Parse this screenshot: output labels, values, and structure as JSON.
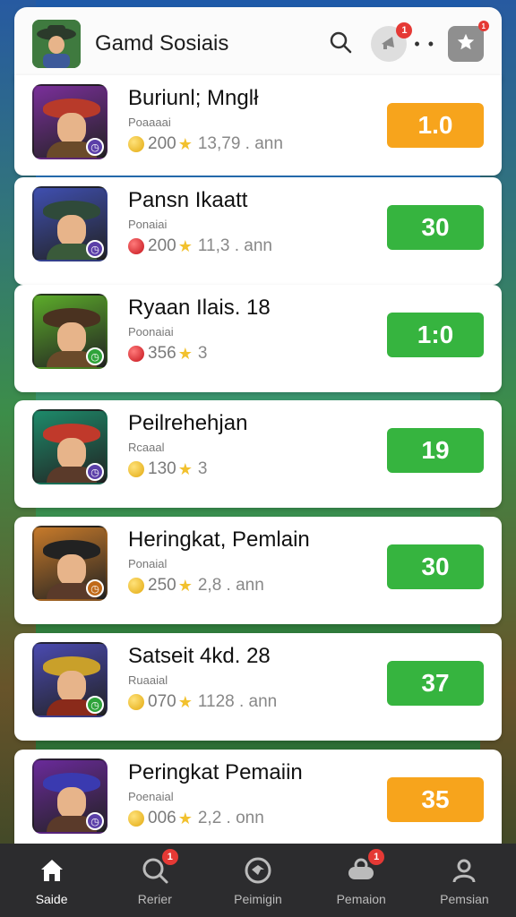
{
  "header": {
    "title": "Gamd Sosiais",
    "notif_count_1": "1",
    "notif_count_2": "1"
  },
  "rows": [
    {
      "name": "Buriunl; Mnglł",
      "sub": "Poaaaai",
      "gem": "gold",
      "coins": "200",
      "extra": "13,79 . ann",
      "score": "1.0",
      "score_color": "orange",
      "theme": {
        "bg": "#7a2f9a",
        "hat": "#b83a2a",
        "body": "#6a4a2a",
        "lvl": "#5b3fa8"
      }
    },
    {
      "name": "Pansn Ikaatt",
      "sub": "Ponaiai",
      "gem": "red",
      "coins": "200",
      "extra": "11,3 . ann",
      "score": "30",
      "score_color": "green",
      "theme": {
        "bg": "#3f4fb0",
        "hat": "#2f4a3a",
        "body": "#3a5a3a",
        "lvl": "#5b3fa8"
      }
    },
    {
      "name": "Ryaan Ilais. 18",
      "sub": "Poonaiai",
      "gem": "red",
      "coins": "356",
      "extra": "3",
      "score": "1:0",
      "score_color": "green",
      "theme": {
        "bg": "#5cab2a",
        "hat": "#4a3220",
        "body": "#6a4a2a",
        "lvl": "#2fa33a"
      }
    },
    {
      "name": "Peilrehehjan",
      "sub": "Rcaaal",
      "gem": "gold",
      "coins": "130",
      "extra": "3",
      "score": "19",
      "score_color": "green",
      "theme": {
        "bg": "#1d8a6a",
        "hat": "#c0392b",
        "body": "#5a3a2a",
        "lvl": "#5b3fa8"
      }
    },
    {
      "name": "Heringkat, Pemlain",
      "sub": "Ponaial",
      "gem": "gold",
      "coins": "250",
      "extra": "2,8 . ann",
      "score": "30",
      "score_color": "green",
      "theme": {
        "bg": "#c77a2a",
        "hat": "#222222",
        "body": "#5a3a2a",
        "lvl": "#c06a1a"
      }
    },
    {
      "name": "Satseit 4kd. 28",
      "sub": "Ruaaial",
      "gem": "gold",
      "coins": "070",
      "extra": "1128 . ann",
      "score": "37",
      "score_color": "green",
      "theme": {
        "bg": "#4a4ab0",
        "hat": "#c9a02a",
        "body": "#8a2a1a",
        "lvl": "#2fa33a"
      }
    },
    {
      "name": "Peringkat Pemaiin",
      "sub": "Poenaial",
      "gem": "gold",
      "coins": "006",
      "extra": "2,2 . onn",
      "score": "35",
      "score_color": "orange",
      "theme": {
        "bg": "#6a2a9a",
        "hat": "#3a3ab0",
        "body": "#5a3a2a",
        "lvl": "#5b3fa8"
      }
    }
  ],
  "tabs": [
    {
      "label": "Saide",
      "icon": "home-icon",
      "active": true,
      "badge": ""
    },
    {
      "label": "Rerier",
      "icon": "search-icon",
      "active": false,
      "badge": "1"
    },
    {
      "label": "Peimigin",
      "icon": "chat-icon",
      "active": false,
      "badge": ""
    },
    {
      "label": "Pemaion",
      "icon": "gamepad-icon",
      "active": false,
      "badge": "1"
    },
    {
      "label": "Pemsian",
      "icon": "profile-icon",
      "active": false,
      "badge": ""
    }
  ]
}
